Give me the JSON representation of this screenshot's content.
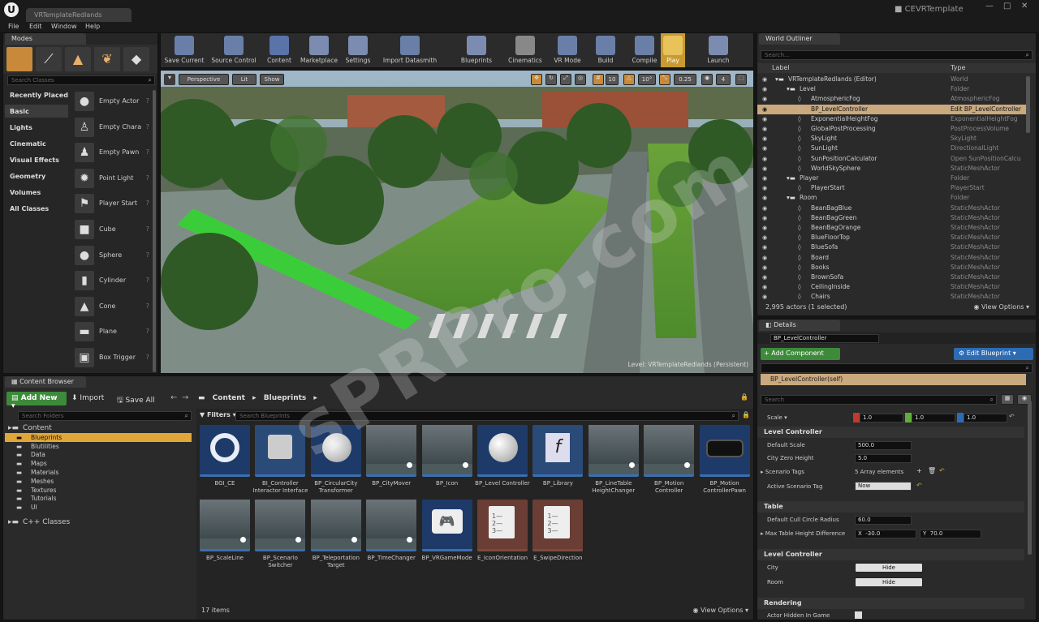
{
  "title_bar": {
    "tab": "VRTemplateRedlands",
    "project": "CEVRTemplate"
  },
  "menu": [
    "File",
    "Edit",
    "Window",
    "Help"
  ],
  "modes": {
    "tab": "Modes",
    "search_placeholder": "Search Classes",
    "categories": [
      "Recently Placed",
      "Basic",
      "Lights",
      "Cinematic",
      "Visual Effects",
      "Geometry",
      "Volumes",
      "All Classes"
    ],
    "items": [
      "Empty Actor",
      "Empty Chara",
      "Empty Pawn",
      "Point Light",
      "Player Start",
      "Cube",
      "Sphere",
      "Cylinder",
      "Cone",
      "Plane",
      "Box Trigger"
    ]
  },
  "toolbar": [
    "Save Current",
    "Source Control",
    "Content",
    "Marketplace",
    "Settings",
    "Import Datasmith",
    "Blueprints",
    "Cinematics",
    "VR Mode",
    "Build",
    "Compile",
    "Play",
    "Launch"
  ],
  "viewport": {
    "perspective": "Perspective",
    "lit": "Lit",
    "show": "Show",
    "angle": "10°",
    "scale": "0.25",
    "grid": "10",
    "cam": "4",
    "level_label": "Level:  VRTemplateRedlands (Persistent)"
  },
  "outliner": {
    "tab": "World Outliner",
    "search_placeholder": "Search...",
    "col_label": "Label",
    "col_type": "Type",
    "rows": [
      {
        "label": "VRTemplateRedlands (Editor)",
        "type": "World",
        "indent": 0
      },
      {
        "label": "Level",
        "type": "Folder",
        "indent": 1
      },
      {
        "label": "AtmosphericFog",
        "type": "AtmosphericFog",
        "indent": 2
      },
      {
        "label": "BP_LevelController",
        "type": "Edit BP_LevelController",
        "indent": 2,
        "selected": true
      },
      {
        "label": "ExponentialHeightFog",
        "type": "ExponentialHeightFog",
        "indent": 2
      },
      {
        "label": "GlobalPostProcessing",
        "type": "PostProcessVolume",
        "indent": 2
      },
      {
        "label": "SkyLight",
        "type": "SkyLight",
        "indent": 2
      },
      {
        "label": "SunLight",
        "type": "DirectionalLight",
        "indent": 2
      },
      {
        "label": "SunPositionCalculator",
        "type": "Open SunPositionCalcu",
        "indent": 2
      },
      {
        "label": "WorldSkySphere",
        "type": "StaticMeshActor",
        "indent": 2
      },
      {
        "label": "Player",
        "type": "Folder",
        "indent": 1
      },
      {
        "label": "PlayerStart",
        "type": "PlayerStart",
        "indent": 2
      },
      {
        "label": "Room",
        "type": "Folder",
        "indent": 1
      },
      {
        "label": "BeanBagBlue",
        "type": "StaticMeshActor",
        "indent": 2
      },
      {
        "label": "BeanBagGreen",
        "type": "StaticMeshActor",
        "indent": 2
      },
      {
        "label": "BeanBagOrange",
        "type": "StaticMeshActor",
        "indent": 2
      },
      {
        "label": "BlueFloorTop",
        "type": "StaticMeshActor",
        "indent": 2
      },
      {
        "label": "BlueSofa",
        "type": "StaticMeshActor",
        "indent": 2
      },
      {
        "label": "Board",
        "type": "StaticMeshActor",
        "indent": 2
      },
      {
        "label": "Books",
        "type": "StaticMeshActor",
        "indent": 2
      },
      {
        "label": "BrownSofa",
        "type": "StaticMeshActor",
        "indent": 2
      },
      {
        "label": "CeilingInside",
        "type": "StaticMeshActor",
        "indent": 2
      },
      {
        "label": "Chairs",
        "type": "StaticMeshActor",
        "indent": 2
      }
    ],
    "footer": "2,995 actors (1 selected)",
    "view_options": "View Options"
  },
  "details": {
    "tab": "Details",
    "name": "BP_LevelController",
    "add_component": "+ Add Component",
    "edit_blueprint": "Edit Blueprint",
    "self_label": "BP_LevelController(self)",
    "search_placeholder": "Search",
    "scale_label": "Scale",
    "scale": [
      "1.0",
      "1.0",
      "1.0"
    ],
    "section1": "Level Controller",
    "default_scale_label": "Default Scale",
    "default_scale": "500.0",
    "city_zero_label": "City Zero Height",
    "city_zero": "5.0",
    "scenario_tags_label": "Scenario Tags",
    "scenario_tags": "5 Array elements",
    "active_tag_label": "Active Scenario Tag",
    "active_tag": "Now",
    "section2": "Table",
    "cull_label": "Default Cull Circle Radius",
    "cull": "60.0",
    "max_table_label": "Max Table Height Difference",
    "max_x": "-30.0",
    "max_y": "70.0",
    "section3": "Level Controller",
    "city_label": "City",
    "room_label": "Room",
    "hide": "Hide",
    "section4": "Rendering",
    "hidden_label": "Actor Hidden In Game"
  },
  "content_browser": {
    "tab": "Content Browser",
    "add_new": "Add New",
    "import": "Import",
    "save_all": "Save All",
    "path": [
      "Content",
      "Blueprints"
    ],
    "folder_search": "Search Folders",
    "filters": "Filters",
    "asset_search": "Search Blueprints",
    "folders": [
      {
        "name": "Content",
        "indent": 0
      },
      {
        "name": "Blueprints",
        "indent": 1,
        "selected": true
      },
      {
        "name": "Blutilities",
        "indent": 1
      },
      {
        "name": "Data",
        "indent": 1
      },
      {
        "name": "Maps",
        "indent": 1
      },
      {
        "name": "Materials",
        "indent": 1
      },
      {
        "name": "Meshes",
        "indent": 1
      },
      {
        "name": "Textures",
        "indent": 1
      },
      {
        "name": "Tutorials",
        "indent": 1
      },
      {
        "name": "UI",
        "indent": 1
      },
      {
        "name": "C++ Classes",
        "indent": 0
      }
    ],
    "assets": [
      {
        "name": "BGI_CE",
        "kind": "ring"
      },
      {
        "name": "BI_Controller Interactor Interface",
        "kind": "iface"
      },
      {
        "name": "BP_CircularCity Transformer",
        "kind": "sphere"
      },
      {
        "name": "BP_CityMover",
        "kind": "scene"
      },
      {
        "name": "BP_Icon",
        "kind": "scene"
      },
      {
        "name": "BP_Level Controller",
        "kind": "sphere"
      },
      {
        "name": "BP_Library",
        "kind": "func"
      },
      {
        "name": "BP_LineTable HeightChanger",
        "kind": "scene"
      },
      {
        "name": "BP_Motion Controller",
        "kind": "scene"
      },
      {
        "name": "BP_Motion ControllerPawn",
        "kind": "vr"
      },
      {
        "name": "BP_ScaleLine",
        "kind": "scene"
      },
      {
        "name": "BP_Scenario Switcher",
        "kind": "scene"
      },
      {
        "name": "BP_Teleportation Target",
        "kind": "scene"
      },
      {
        "name": "BP_TimeChanger",
        "kind": "scene"
      },
      {
        "name": "BP_VRGameMode",
        "kind": "gamepad"
      },
      {
        "name": "E_IconOrientation",
        "kind": "enum"
      },
      {
        "name": "E_SwipeDirection",
        "kind": "enum"
      }
    ],
    "count": "17 items",
    "view_options": "View Options"
  },
  "watermark": "sPRPro.com"
}
